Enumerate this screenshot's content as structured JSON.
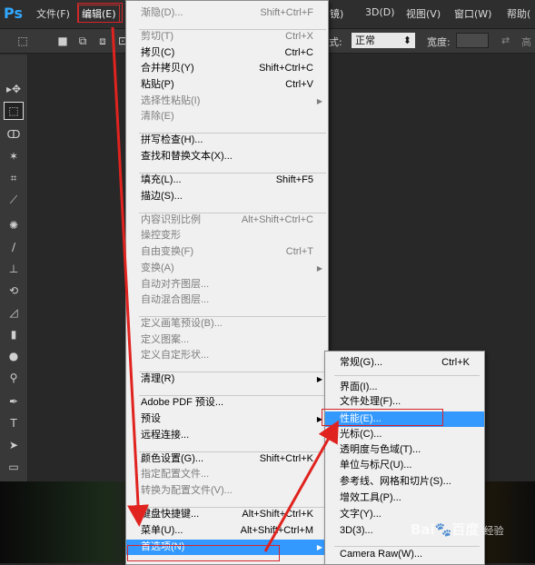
{
  "app": {
    "logo": "Ps"
  },
  "menubar": {
    "items": [
      {
        "label": "文件(F)"
      },
      {
        "label": "编辑(E)"
      },
      {
        "label": "镜)"
      },
      {
        "label": "3D(D)"
      },
      {
        "label": "视图(V)"
      },
      {
        "label": "窗口(W)"
      },
      {
        "label": "帮助("
      }
    ]
  },
  "options_bar": {
    "style_label": "式:",
    "style_value": "正常",
    "width_label": "宽度:"
  },
  "edit_menu": {
    "items": [
      {
        "label": "渐隐(D)...",
        "shortcut": "Shift+Ctrl+F",
        "disabled": true
      },
      {
        "label": "剪切(T)",
        "shortcut": "Ctrl+X",
        "disabled": true
      },
      {
        "label": "拷贝(C)",
        "shortcut": "Ctrl+C",
        "disabled": false
      },
      {
        "label": "合并拷贝(Y)",
        "shortcut": "Shift+Ctrl+C",
        "disabled": false
      },
      {
        "label": "粘贴(P)",
        "shortcut": "Ctrl+V",
        "disabled": false
      },
      {
        "label": "选择性粘贴(I)",
        "shortcut": "",
        "disabled": true
      },
      {
        "label": "清除(E)",
        "shortcut": "",
        "disabled": true
      },
      {
        "label": "拼写检查(H)...",
        "shortcut": "",
        "disabled": false
      },
      {
        "label": "查找和替换文本(X)...",
        "shortcut": "",
        "disabled": false
      },
      {
        "label": "填充(L)...",
        "shortcut": "Shift+F5",
        "disabled": false
      },
      {
        "label": "描边(S)...",
        "shortcut": "",
        "disabled": false
      },
      {
        "label": "内容识别比例",
        "shortcut": "Alt+Shift+Ctrl+C",
        "disabled": true
      },
      {
        "label": "操控变形",
        "shortcut": "",
        "disabled": true
      },
      {
        "label": "自由变换(F)",
        "shortcut": "Ctrl+T",
        "disabled": true
      },
      {
        "label": "变换(A)",
        "shortcut": "",
        "disabled": true
      },
      {
        "label": "自动对齐图层...",
        "shortcut": "",
        "disabled": true
      },
      {
        "label": "自动混合图层...",
        "shortcut": "",
        "disabled": true
      },
      {
        "label": "定义画笔预设(B)...",
        "shortcut": "",
        "disabled": true
      },
      {
        "label": "定义图案...",
        "shortcut": "",
        "disabled": true
      },
      {
        "label": "定义自定形状...",
        "shortcut": "",
        "disabled": true
      },
      {
        "label": "清理(R)",
        "shortcut": "",
        "disabled": false
      },
      {
        "label": "Adobe PDF 预设...",
        "shortcut": "",
        "disabled": false
      },
      {
        "label": "预设",
        "shortcut": "",
        "disabled": false
      },
      {
        "label": "远程连接...",
        "shortcut": "",
        "disabled": false
      },
      {
        "label": "颜色设置(G)...",
        "shortcut": "Shift+Ctrl+K",
        "disabled": false
      },
      {
        "label": "指定配置文件...",
        "shortcut": "",
        "disabled": true
      },
      {
        "label": "转换为配置文件(V)...",
        "shortcut": "",
        "disabled": true
      },
      {
        "label": "键盘快捷键...",
        "shortcut": "Alt+Shift+Ctrl+K",
        "disabled": false
      },
      {
        "label": "菜单(U)...",
        "shortcut": "Alt+Shift+Ctrl+M",
        "disabled": false
      },
      {
        "label": "首选项(N)",
        "shortcut": "",
        "disabled": false
      }
    ]
  },
  "prefs_submenu": {
    "items": [
      {
        "label": "常规(G)...",
        "shortcut": "Ctrl+K"
      },
      {
        "label": "界面(I)...",
        "shortcut": ""
      },
      {
        "label": "文件处理(F)...",
        "shortcut": ""
      },
      {
        "label": "性能(E)...",
        "shortcut": ""
      },
      {
        "label": "光标(C)...",
        "shortcut": ""
      },
      {
        "label": "透明度与色域(T)...",
        "shortcut": ""
      },
      {
        "label": "单位与标尺(U)...",
        "shortcut": ""
      },
      {
        "label": "参考线、网格和切片(S)...",
        "shortcut": ""
      },
      {
        "label": "增效工具(P)...",
        "shortcut": ""
      },
      {
        "label": "文字(Y)...",
        "shortcut": ""
      },
      {
        "label": "3D(3)...",
        "shortcut": ""
      },
      {
        "label": "Camera Raw(W)...",
        "shortcut": ""
      }
    ]
  },
  "watermark": {
    "brand": "Bai",
    "brand_end": "百度",
    "sub": "经验"
  },
  "colors": {
    "highlight": "#3399ff",
    "annotation_red": "#d8232a",
    "menu_bg": "#f0f0f0"
  }
}
